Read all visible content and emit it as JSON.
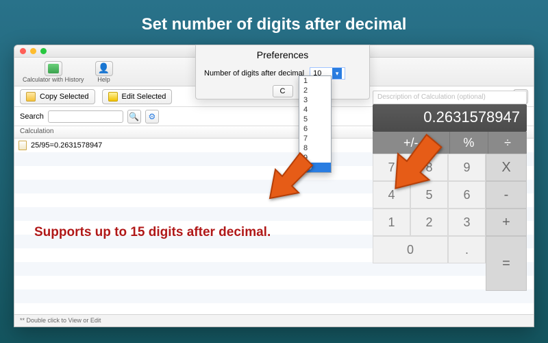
{
  "hero": {
    "title": "Set number of digits after decimal"
  },
  "window": {
    "title": "Calculator with History",
    "toolbar": {
      "calc_label": "Calculator with History",
      "help_label": "Help"
    },
    "actions": {
      "copy_label": "Copy Selected",
      "edit_label": "Edit Selected"
    },
    "search": {
      "label": "Search",
      "value": ""
    },
    "list": {
      "header": "Calculation",
      "rows": [
        {
          "text": "25/95=0.2631578947"
        }
      ]
    },
    "footer": "** Double click to View or Edit"
  },
  "prefs": {
    "title": "Preferences",
    "field_label": "Number of digits after decimal",
    "value": "10",
    "options": [
      "1",
      "2",
      "3",
      "4",
      "5",
      "6",
      "7",
      "8",
      "9",
      "10"
    ],
    "selected": "10"
  },
  "calculator": {
    "description_placeholder": "Description of Calculation (optional)",
    "display": "0.2631578947",
    "ops_row": [
      "+/-",
      "%",
      "÷"
    ],
    "side_ops": [
      "X",
      "-",
      "+",
      "="
    ],
    "keys": [
      "7",
      "8",
      "9",
      "4",
      "5",
      "6",
      "1",
      "2",
      "3",
      "0",
      "."
    ]
  },
  "annotations": {
    "caption": "Supports up to 15 digits after decimal."
  },
  "colors": {
    "accent": "#2a7de1",
    "warn": "#b01818"
  }
}
